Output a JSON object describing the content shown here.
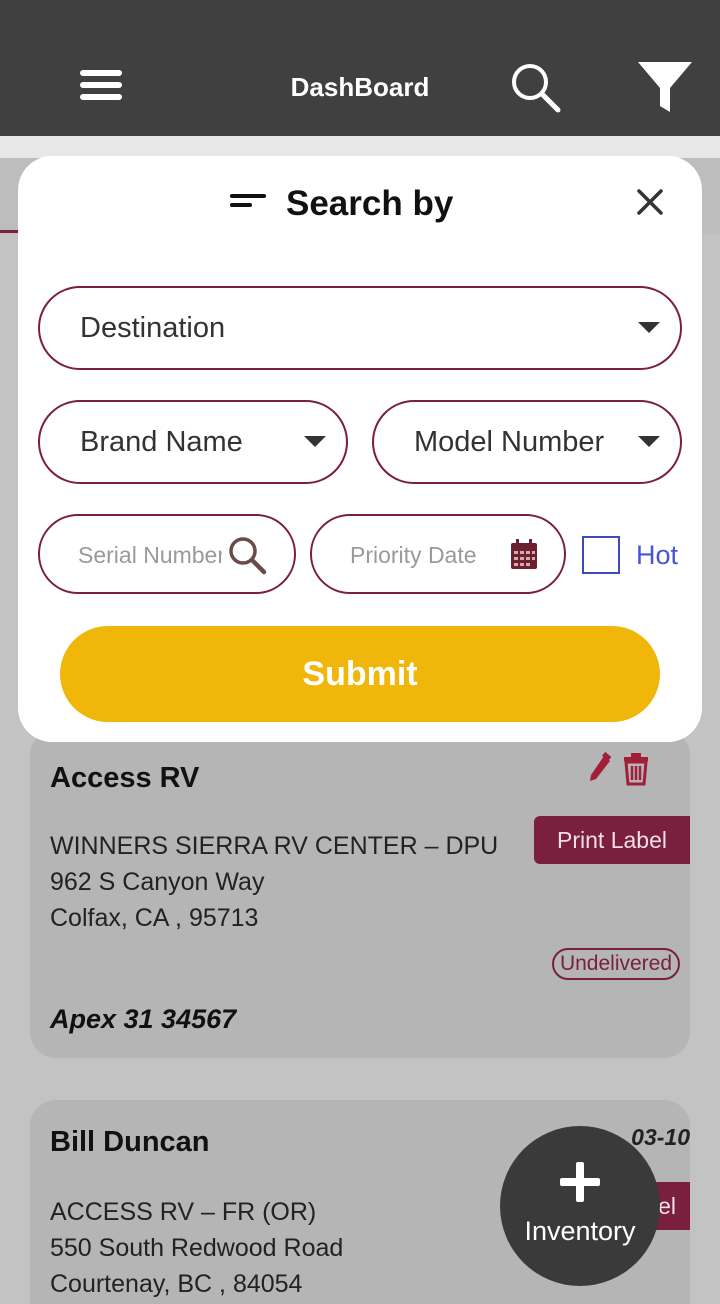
{
  "header": {
    "title": "DashBoard",
    "menu_icon": "hamburger-menu-icon",
    "search_icon": "search-icon",
    "filter_icon": "filter-icon"
  },
  "search_modal": {
    "title": "Search by",
    "destination_label": "Destination",
    "brand_label": "Brand Name",
    "model_label": "Model Number",
    "serial_placeholder": "Serial Number",
    "priority_placeholder": "Priority Date",
    "hot_label": "Hot",
    "submit_label": "Submit"
  },
  "cards": [
    {
      "name": "Access RV",
      "address_line1": "WINNERS SIERRA RV CENTER – DPU",
      "address_line2": "962 S Canyon Way",
      "address_line3": "Colfax, CA , 95713",
      "print_label": "Print Label",
      "status": "Undelivered",
      "model": "Apex 31 34567"
    },
    {
      "name": "Bill Duncan",
      "date_partial": "03-10",
      "address_line1": "ACCESS RV – FR (OR)",
      "address_line2": "550 South Redwood Road",
      "address_line3": "Courtenay, BC , 84054",
      "label_partial": "el"
    }
  ],
  "fab": {
    "label": "Inventory"
  },
  "colors": {
    "accent": "#7a1f3d",
    "submit": "#f0b70a",
    "header": "#404040",
    "hot": "#4a53d6"
  }
}
